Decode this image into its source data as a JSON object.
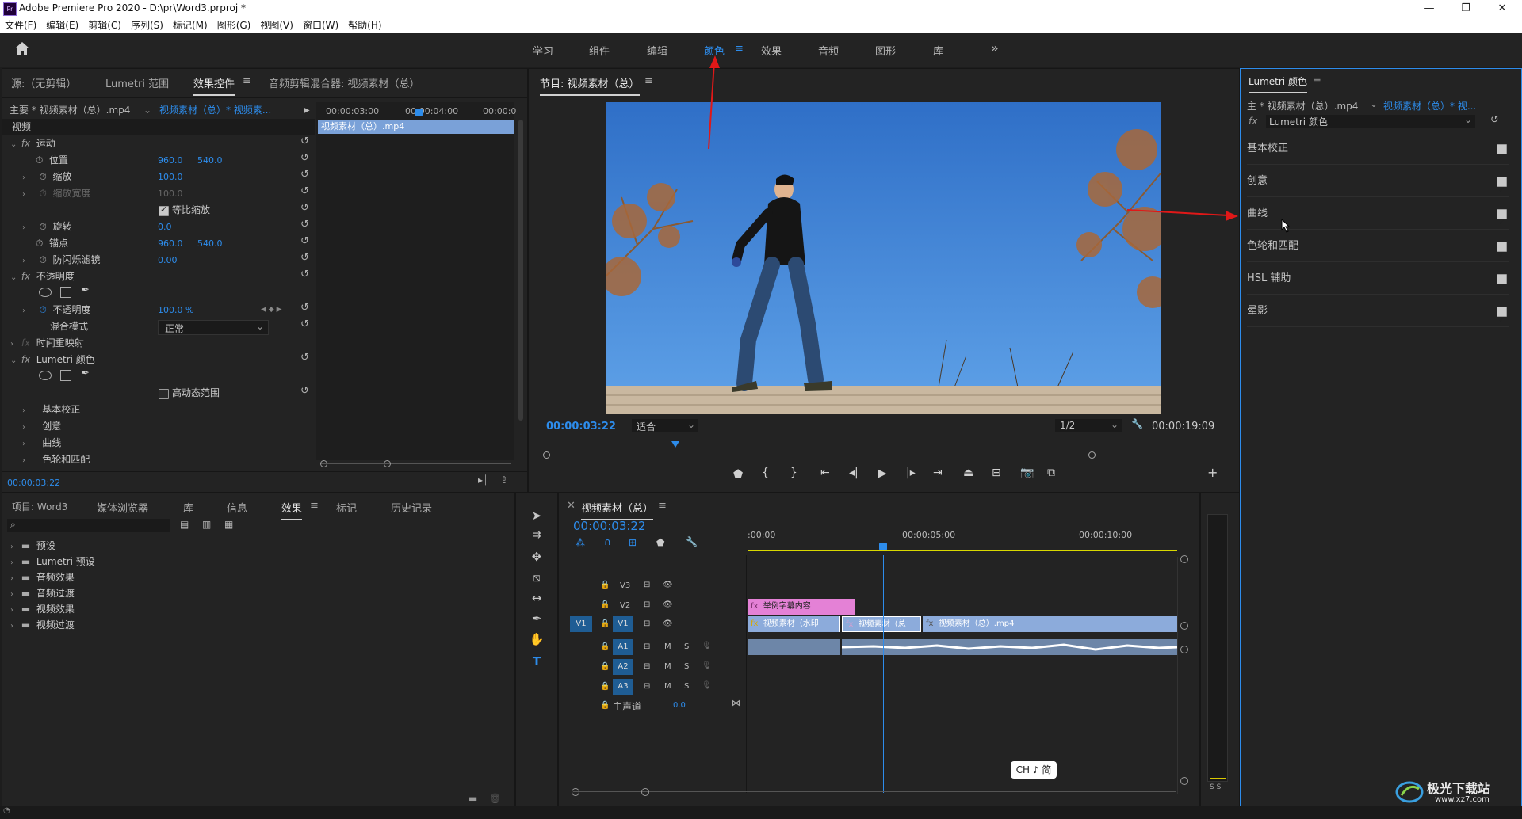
{
  "titlebar": {
    "title": "Adobe Premiere Pro 2020 - D:\\pr\\Word3.prproj *",
    "app_icon": "Pr"
  },
  "menu": [
    "文件(F)",
    "编辑(E)",
    "剪辑(C)",
    "序列(S)",
    "标记(M)",
    "图形(G)",
    "视图(V)",
    "窗口(W)",
    "帮助(H)"
  ],
  "workspaces": [
    "学习",
    "组件",
    "编辑",
    "颜色",
    "效果",
    "音频",
    "图形",
    "库"
  ],
  "active_workspace": "颜色",
  "source_panel": {
    "tabs": [
      "源:（无剪辑）",
      "Lumetri 范围",
      "效果控件",
      "音频剪辑混合器: 视频素材（总）"
    ],
    "active_tab": "效果控件",
    "master": "主要 * 视频素材（总）.mp4",
    "sequence_clip": "视频素材（总）* 视频素...",
    "ruler": [
      "00:00:03:00",
      "00:00:04:00",
      "00:00:0"
    ],
    "clip_bar": "视频素材（总）.mp4",
    "section": "视频",
    "motion": "运动",
    "position_label": "位置",
    "position_x": "960.0",
    "position_y": "540.0",
    "scale_label": "缩放",
    "scale_value": "100.0",
    "scale_width_label": "缩放宽度",
    "scale_width_value": "100.0",
    "uniform_scale": "等比缩放",
    "rotation_label": "旋转",
    "rotation_value": "0.0",
    "anchor_label": "锚点",
    "anchor_x": "960.0",
    "anchor_y": "540.0",
    "antiflicker_label": "防闪烁滤镜",
    "antiflicker_value": "0.00",
    "opacity_section": "不透明度",
    "opacity_label": "不透明度",
    "opacity_value": "100.0 %",
    "blend_label": "混合模式",
    "blend_value": "正常",
    "time_remap": "时间重映射",
    "lumetri": "Lumetri 颜色",
    "hdr": "高动态范围",
    "lumetri_items": [
      "基本校正",
      "创意",
      "曲线",
      "色轮和匹配"
    ],
    "timecode": "00:00:03:22"
  },
  "program_monitor": {
    "title": "节目: 视频素材（总）",
    "timecode": "00:00:03:22",
    "fit": "适合",
    "resolution": "1/2",
    "duration": "00:00:19:09"
  },
  "lumetri_panel": {
    "title": "Lumetri 颜色",
    "master": "主 * 视频素材（总）.mp4",
    "seq": "视频素材（总）* 视...",
    "fx": "Lumetri 颜色",
    "sections": [
      {
        "label": "基本校正",
        "checked": true
      },
      {
        "label": "创意",
        "checked": true
      },
      {
        "label": "曲线",
        "checked": true
      },
      {
        "label": "色轮和匹配",
        "checked": true
      },
      {
        "label": "HSL 辅助",
        "checked": true
      },
      {
        "label": "晕影",
        "checked": true
      }
    ]
  },
  "project_panel": {
    "tabs": [
      "项目: Word3",
      "媒体浏览器",
      "库",
      "信息",
      "效果",
      "标记",
      "历史记录"
    ],
    "active_tab": "效果",
    "folders": [
      "预设",
      "Lumetri 预设",
      "音频效果",
      "音频过渡",
      "视频效果",
      "视频过渡"
    ]
  },
  "timeline": {
    "title": "视频素材（总）",
    "timecode": "00:00:03:22",
    "ruler": [
      ":00:00",
      "00:00:05:00",
      "00:00:10:00"
    ],
    "video_tracks": [
      "V3",
      "V2",
      "V1"
    ],
    "audio_tracks": [
      "A1",
      "A2",
      "A3"
    ],
    "source_patch": "V1",
    "master_label": "主声道",
    "master_value": "0.0",
    "clip_v2": "举例字幕内容",
    "clip_v1_a": "视频素材（水印",
    "clip_v1_b": "视频素材（总",
    "clip_v1_c": "视频素材（总）.mp4",
    "m": "M",
    "s": "S"
  },
  "meter": {
    "labels": "S S"
  },
  "ime": "CH ♪ 简",
  "watermark": "极光下载站",
  "watermark_url": "www.xz7.com"
}
